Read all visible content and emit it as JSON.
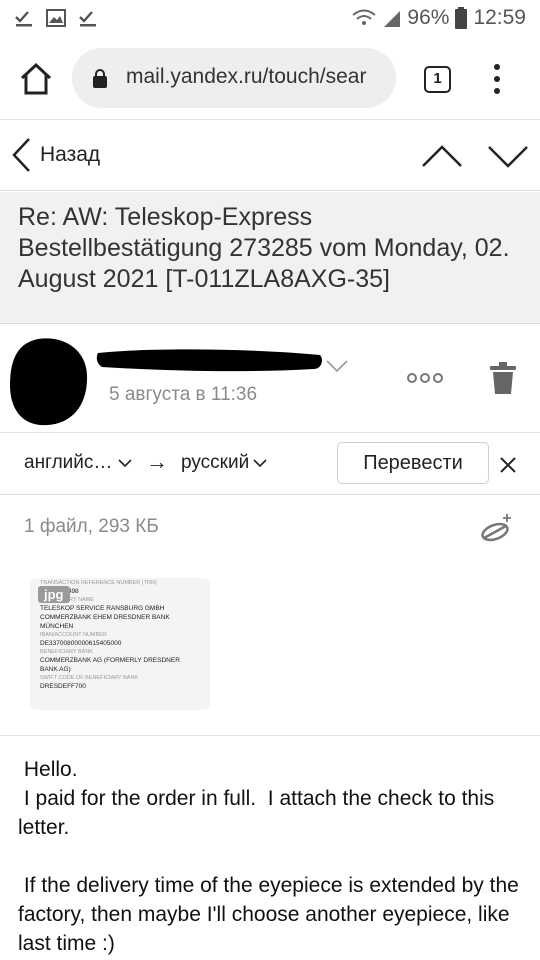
{
  "status_bar": {
    "battery": "96%",
    "time": "12:59"
  },
  "browser": {
    "url": "mail.yandex.ru/touch/sear",
    "tab_count": "1"
  },
  "message_nav": {
    "back_label": "Назад"
  },
  "message": {
    "subject": "Re: AW: Teleskop-Express Bestellbestätigung 273285 vom Monday, 02. August 2021 [T-011ZLA8AXG-35]",
    "date": "5 августа в 11:36"
  },
  "translate": {
    "from_lang": "английс…",
    "arrow": "→",
    "to_lang": "русский",
    "button_label": "Перевести"
  },
  "attachments": {
    "count_text": "1 файл, 293 КБ",
    "thumb_badge": "jpg",
    "thumb_lines": [
      {
        "cap": "TRANSACTION REFERENCE NUMBER (TRN)",
        "val": ""
      },
      {
        "cap": "",
        "val": "S550            530498"
      },
      {
        "cap": "BENEFICIARY NAME",
        "val": ""
      },
      {
        "cap": "",
        "val": "TELESKOP SERVICE RANSBURG GMBH"
      },
      {
        "cap": "",
        "val": "COMMERZBANK EHEM DRESDNER BANK"
      },
      {
        "cap": "",
        "val": "MÜNCHEN"
      },
      {
        "cap": "IBAN/ACCOUNT NUMBER",
        "val": ""
      },
      {
        "cap": "",
        "val": "DE33700800000615405000"
      },
      {
        "cap": "BENEFICIARY BANK",
        "val": ""
      },
      {
        "cap": "",
        "val": "COMMERZBANK AG (FORMERLY DRESDNER"
      },
      {
        "cap": "",
        "val": "BANK AG)"
      },
      {
        "cap": "SWIFT CODE OF BENEFICIARY BANK",
        "val": ""
      },
      {
        "cap": "",
        "val": "DRESDEFF700"
      }
    ]
  },
  "body": {
    "lines": [
      " Hello.",
      " I paid for the order in full.  I attach the check to this letter.",
      "",
      " If the delivery time of the eyepiece is extended by the factory, then maybe I'll choose another eyepiece, like last time :)"
    ]
  },
  "colors": {
    "subject_bg": "#f1f1f1",
    "text_primary": "#222222",
    "text_secondary": "#8a8a8a",
    "urlbar_bg": "#eeeeee"
  }
}
